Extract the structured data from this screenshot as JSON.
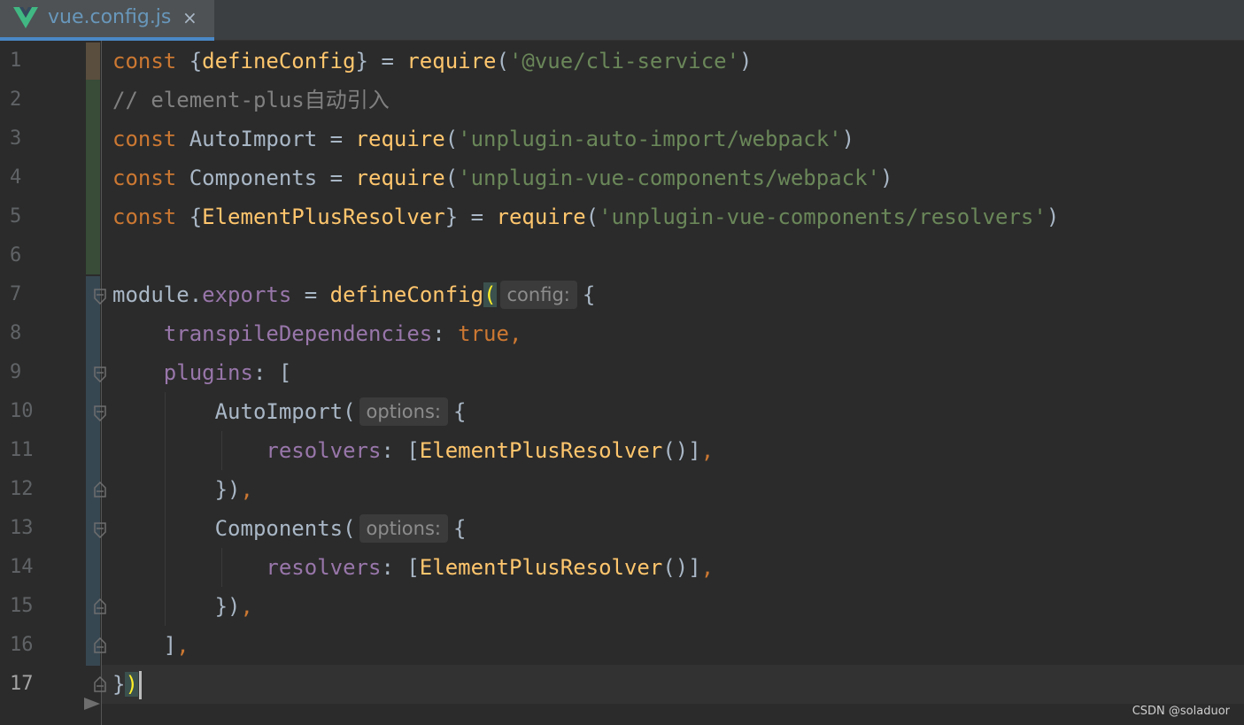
{
  "tab": {
    "title": "vue.config.js",
    "close_glyph": "×",
    "icon": "vue-logo-icon"
  },
  "editor": {
    "current_line": 17,
    "line_numbers": [
      "1",
      "2",
      "3",
      "4",
      "5",
      "6",
      "7",
      "8",
      "9",
      "10",
      "11",
      "12",
      "13",
      "14",
      "15",
      "16",
      "17"
    ],
    "lines": [
      [
        "const",
        " {",
        "defineConfig",
        "} = ",
        "require",
        "(",
        "'@vue/cli-service'",
        ")"
      ],
      [
        "// element-plus自动引入"
      ],
      [
        "const",
        " AutoImport = ",
        "require",
        "(",
        "'unplugin-auto-import/webpack'",
        ")"
      ],
      [
        "const",
        " Components = ",
        "require",
        "(",
        "'unplugin-vue-components/webpack'",
        ")"
      ],
      [
        "const",
        " {",
        "ElementPlusResolver",
        "} = ",
        "require",
        "(",
        "'unplugin-vue-components/resolvers'",
        ")"
      ],
      [],
      [
        "module.",
        "exports",
        " = ",
        "defineConfig",
        "(",
        "config:",
        "{"
      ],
      [
        "    ",
        "transpileDependencies",
        ": ",
        "true",
        ","
      ],
      [
        "    ",
        "plugins",
        ": ["
      ],
      [
        "        AutoImport(",
        "options:",
        "{"
      ],
      [
        "            ",
        "resolvers",
        ": [",
        "ElementPlusResolver",
        "()]",
        ","
      ],
      [
        "        })",
        ","
      ],
      [
        "        Components(",
        "options:",
        "{"
      ],
      [
        "            ",
        "resolvers",
        ": [",
        "ElementPlusResolver",
        "()]",
        ","
      ],
      [
        "        })",
        ","
      ],
      [
        "    ]",
        ","
      ],
      [
        "}",
        ")"
      ]
    ]
  },
  "colors": {
    "background": "#2b2b2b",
    "keyword": "#cc7832",
    "function": "#ffc66d",
    "string": "#6a8759",
    "comment": "#808080",
    "property": "#9876aa",
    "text": "#a9b7c6",
    "tab_underline": "#4a88c7"
  },
  "watermark": "CSDN @soladuor"
}
